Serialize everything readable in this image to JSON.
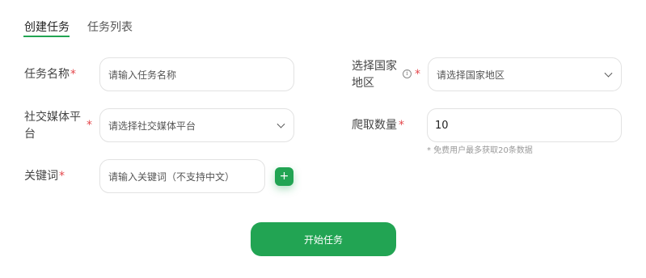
{
  "tabs": [
    {
      "label": "创建任务",
      "active": true
    },
    {
      "label": "任务列表",
      "active": false
    }
  ],
  "form": {
    "task_name": {
      "label": "任务名称",
      "required_mark": "*",
      "placeholder": "请输入任务名称"
    },
    "country": {
      "label_line1": "选择国家",
      "label_line2": "地区",
      "info_icon": "info-icon",
      "required_mark": "*",
      "placeholder": "请选择国家地区"
    },
    "platform": {
      "label_line1": "社交媒体平",
      "label_line2": "台",
      "required_mark": "*",
      "placeholder": "请选择社交媒体平台"
    },
    "crawl_count": {
      "label": "爬取数量",
      "required_mark": "*",
      "value": "10",
      "hint": "* 免费用户最多获取20条数据"
    },
    "keyword": {
      "label": "关键词",
      "required_mark": "*",
      "placeholder": "请输入关键词（不支持中文）",
      "add_label": "+"
    }
  },
  "start_button": {
    "label": "开始任务"
  },
  "colors": {
    "accent": "#22a453",
    "required": "#e5484d"
  }
}
